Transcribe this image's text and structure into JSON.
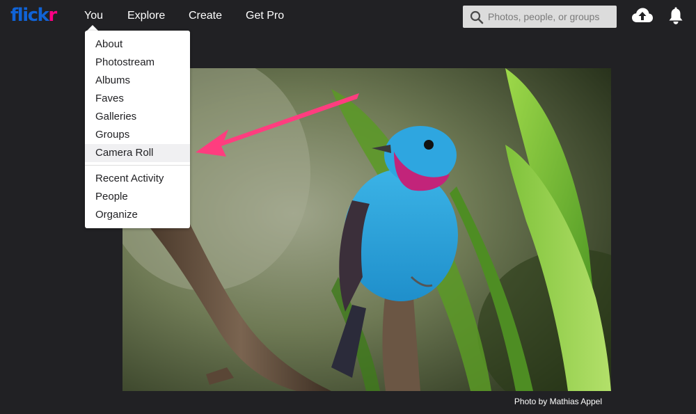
{
  "brand": {
    "logo_main": "flick",
    "logo_accent": "r",
    "color_blue": "#1063d6",
    "color_pink": "#ff0084"
  },
  "nav": {
    "items": [
      {
        "label": "You"
      },
      {
        "label": "Explore"
      },
      {
        "label": "Create"
      },
      {
        "label": "Get Pro"
      }
    ]
  },
  "search": {
    "placeholder": "Photos, people, or groups",
    "icon": "search-icon"
  },
  "header_icons": {
    "upload": "cloud-upload-icon",
    "notifications": "bell-icon"
  },
  "you_menu": {
    "items": [
      {
        "label": "About"
      },
      {
        "label": "Photostream"
      },
      {
        "label": "Albums"
      },
      {
        "label": "Faves"
      },
      {
        "label": "Galleries"
      },
      {
        "label": "Groups"
      },
      {
        "label": "Camera Roll"
      },
      {
        "label": "Recent Activity"
      },
      {
        "label": "People"
      },
      {
        "label": "Organize"
      }
    ],
    "highlighted": "Camera Roll"
  },
  "annotation": {
    "arrow_color": "#ff3d7f"
  },
  "photo": {
    "credit": "Photo by Mathias Appel"
  }
}
